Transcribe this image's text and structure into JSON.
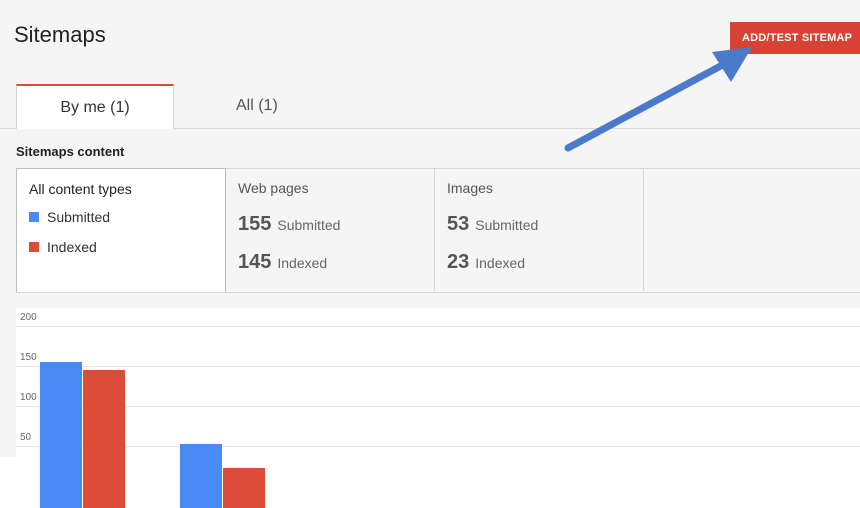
{
  "header": {
    "title": "Sitemaps",
    "add_button_label": "ADD/TEST SITEMAP"
  },
  "tabs": [
    {
      "label": "By me (1)",
      "active": true
    },
    {
      "label": "All (1)",
      "active": false
    }
  ],
  "content": {
    "section_label": "Sitemaps content",
    "legend": {
      "title": "All content types",
      "items": [
        {
          "label": "Submitted",
          "color": "#4a8af4"
        },
        {
          "label": "Indexed",
          "color": "#dd4b39"
        }
      ]
    },
    "stats": [
      {
        "heading": "Web pages",
        "submitted": "155",
        "submitted_label": "Submitted",
        "indexed": "145",
        "indexed_label": "Indexed"
      },
      {
        "heading": "Images",
        "submitted": "53",
        "submitted_label": "Submitted",
        "indexed": "23",
        "indexed_label": "Indexed"
      }
    ]
  },
  "chart_data": {
    "type": "bar",
    "categories": [
      "Web pages",
      "Images"
    ],
    "series": [
      {
        "name": "Submitted",
        "values": [
          155,
          53
        ],
        "color": "#4a8af4"
      },
      {
        "name": "Indexed",
        "values": [
          145,
          23
        ],
        "color": "#dd4b39"
      }
    ],
    "yticks": [
      "200",
      "150",
      "100",
      "50"
    ],
    "ylim": [
      0,
      200
    ],
    "grid": true
  },
  "annotation": {
    "arrow_color": "#4a7ac9"
  }
}
